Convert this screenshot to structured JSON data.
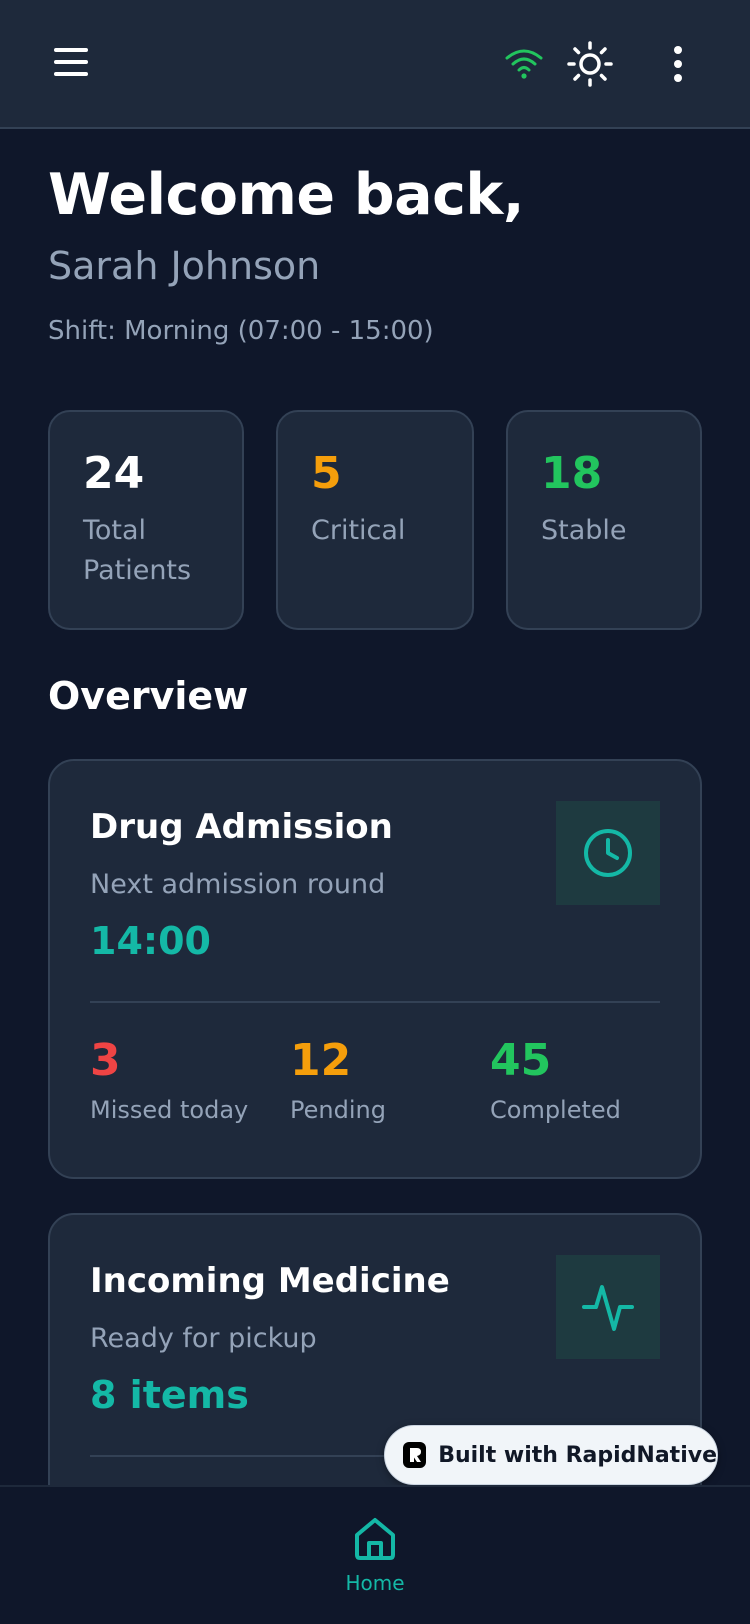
{
  "header": {
    "icons": {
      "menu": "menu-icon",
      "wifi": "wifi-icon",
      "theme": "sun-icon",
      "more": "more-vertical-icon"
    },
    "wifi_color": "#22c55e"
  },
  "welcome": {
    "title": "Welcome back,",
    "name": "Sarah Johnson",
    "shift": "Shift: Morning (07:00 - 15:00)"
  },
  "stats": [
    {
      "value": "24",
      "label": "Total Patients",
      "color": "#ffffff"
    },
    {
      "value": "5",
      "label": "Critical",
      "color": "#f59e0b"
    },
    {
      "value": "18",
      "label": "Stable",
      "color": "#22c55e"
    }
  ],
  "overview": {
    "title": "Overview",
    "cards": [
      {
        "title": "Drug Admission",
        "subtitle": "Next admission round",
        "value": "14:00",
        "icon": "clock-icon",
        "metrics": [
          {
            "value": "3",
            "label": "Missed today",
            "color": "#ef4444"
          },
          {
            "value": "12",
            "label": "Pending",
            "color": "#f59e0b"
          },
          {
            "value": "45",
            "label": "Completed",
            "color": "#22c55e"
          }
        ]
      },
      {
        "title": "Incoming Medicine",
        "subtitle": "Ready for pickup",
        "value": "8 items",
        "icon": "activity-icon"
      }
    ]
  },
  "accent_color": "#14b8a6",
  "badge": {
    "text": "Built with RapidNative"
  },
  "bottom_nav": {
    "items": [
      {
        "label": "Home",
        "icon": "home-icon",
        "active": true
      }
    ]
  }
}
